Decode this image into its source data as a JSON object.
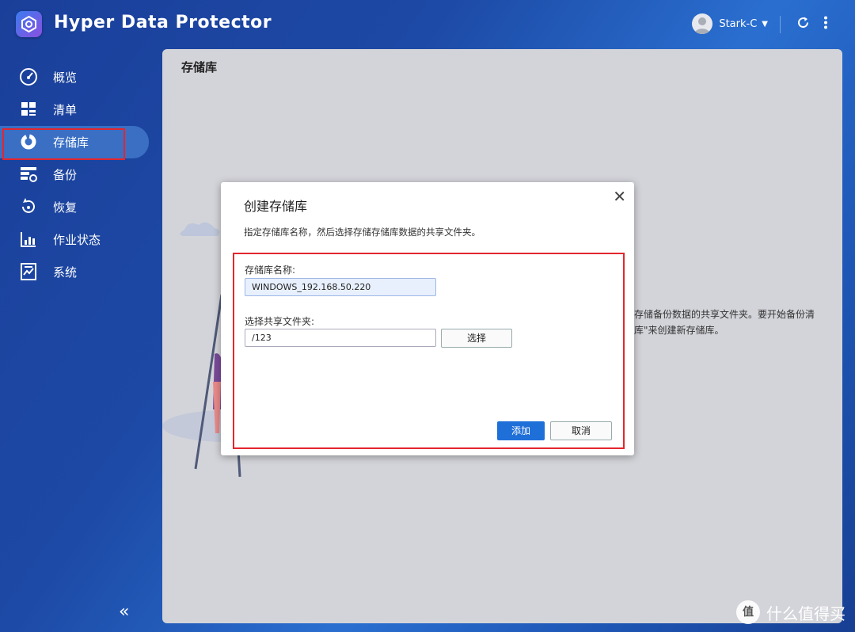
{
  "app": {
    "title": "Hyper Data Protector"
  },
  "header": {
    "user_name": "Stark-C",
    "icons": [
      "refresh-icon",
      "more-vertical-icon"
    ]
  },
  "sidebar": {
    "items": [
      {
        "label": "概览",
        "icon": "dashboard-gauge-icon"
      },
      {
        "label": "清单",
        "icon": "inventory-grid-icon"
      },
      {
        "label": "存储库",
        "icon": "storage-donut-icon",
        "active": true
      },
      {
        "label": "备份",
        "icon": "backup-icon"
      },
      {
        "label": "恢复",
        "icon": "restore-icon"
      },
      {
        "label": "作业状态",
        "icon": "job-status-chart-icon"
      },
      {
        "label": "系统",
        "icon": "system-icon"
      }
    ],
    "collapse_label": "«"
  },
  "main": {
    "title": "存储库",
    "bg_text_line1": "于存储备份数据的共享文件夹。要开始备份清",
    "bg_text_line2": "储库\"来创建新存储库。"
  },
  "dialog": {
    "title": "创建存储库",
    "close_label": "✕",
    "description": "指定存储库名称，然后选择存储存储库数据的共享文件夹。",
    "name_label": "存储库名称:",
    "name_value": "WINDOWS_192.168.50.220",
    "folder_label": "选择共享文件夹:",
    "folder_value": "/123",
    "select_button": "选择",
    "add_button": "添加",
    "cancel_button": "取消"
  },
  "watermark": {
    "text": "什么值得买",
    "logo_text": "值"
  },
  "colors": {
    "accent": "#1f6fd8",
    "highlight": "#e3262e",
    "sidebar_active": "#3a6fc4"
  }
}
